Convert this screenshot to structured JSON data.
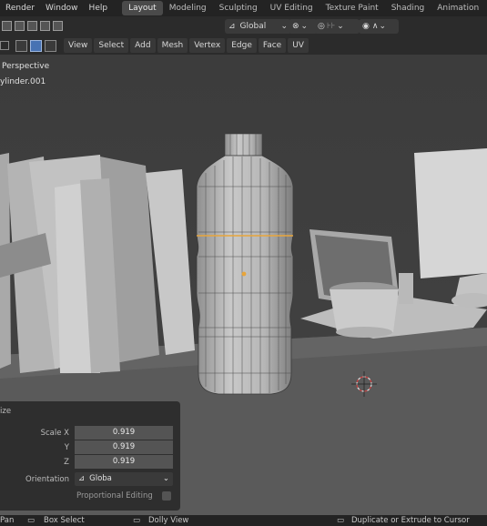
{
  "menu": {
    "render": "Render",
    "window": "Window",
    "help": "Help"
  },
  "workspaces": [
    "Layout",
    "Modeling",
    "Sculpting",
    "UV Editing",
    "Texture Paint",
    "Shading",
    "Animation"
  ],
  "active_workspace": "Layout",
  "header_tools": {
    "orientation": "Global",
    "pivot_icon": "pivot-icon",
    "snap_icon": "snap-icon",
    "proportional_icon": "proportional-icon"
  },
  "edit_menu": [
    "View",
    "Select",
    "Add",
    "Mesh",
    "Vertex",
    "Edge",
    "Face",
    "UV"
  ],
  "viewport": {
    "view_label": "Perspective",
    "object_name": "ylinder.001"
  },
  "operator_panel": {
    "title": "ize",
    "scale_x_label": "Scale X",
    "scale_x": "0.919",
    "y_label": "Y",
    "y": "0.919",
    "z_label": "Z",
    "z": "0.919",
    "orientation_label": "Orientation",
    "orientation_value": "Globa",
    "proportional_label": "Proportional Editing"
  },
  "status": {
    "pan": "Pan",
    "box_select": "Box Select",
    "dolly": "Dolly View",
    "duplicate": "Duplicate or Extrude to Cursor"
  },
  "colors": {
    "accent": "#4772b3",
    "edge_highlight": "#e8a53b",
    "background": "#3d3d3d"
  }
}
